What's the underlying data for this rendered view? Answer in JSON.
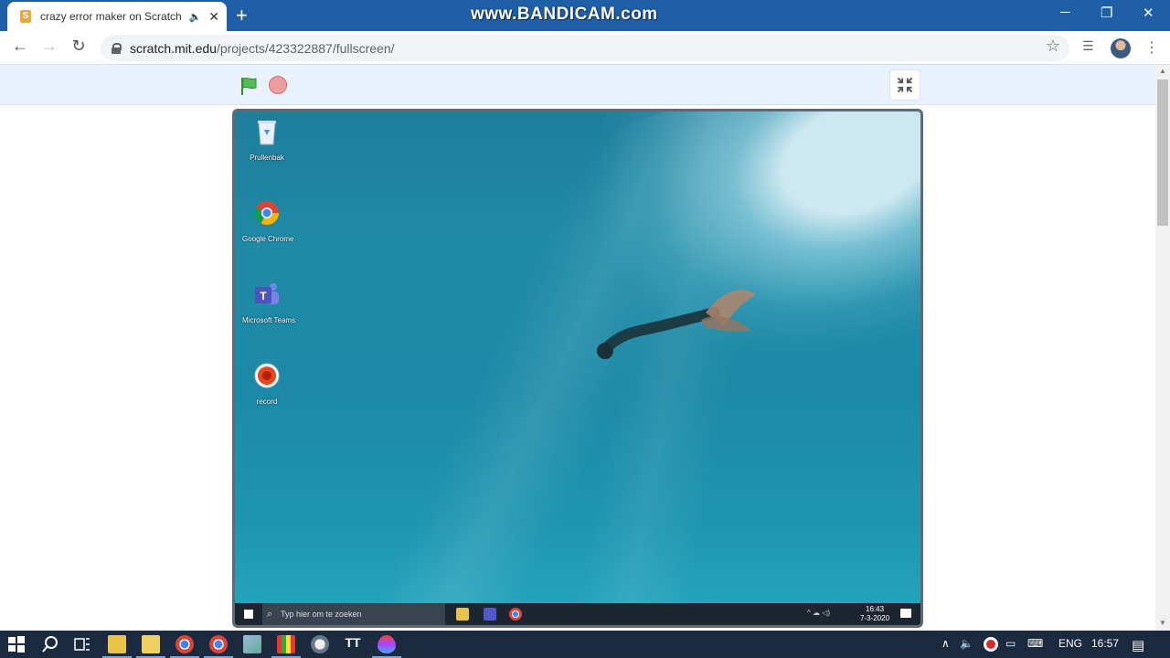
{
  "watermark": "www.BANDICAM.com",
  "browser": {
    "tab_title": "crazy error maker on Scratch",
    "tab_audio_icon": "speaker-icon",
    "tab_close": "✕",
    "new_tab": "+",
    "url_host": "scratch.mit.edu",
    "url_path": "/projects/423322887/fullscreen/",
    "window_controls": {
      "minimize": "─",
      "restore": "❐",
      "close": "✕"
    },
    "nav": {
      "back": "←",
      "forward": "→",
      "reload": "↻"
    },
    "bookmark": "☆",
    "menu": "⋮"
  },
  "scratch": {
    "green_flag_icon": "green-flag-icon",
    "stop_icon": "stop-icon",
    "exit_fullscreen_icon": "exit-fullscreen-icon"
  },
  "stage": {
    "desktop_icons": [
      {
        "label": "Prullenbak",
        "icon": "recycle-bin-icon"
      },
      {
        "label": "Google Chrome",
        "icon": "chrome-icon"
      },
      {
        "label": "Microsoft Teams",
        "icon": "teams-icon"
      },
      {
        "label": "record",
        "icon": "record-icon"
      }
    ],
    "taskbar_search_placeholder": "Typ hier om te zoeken",
    "clock_time": "16:43",
    "clock_date": "7-3-2020"
  },
  "taskbar": {
    "language": "ENG",
    "time": "16:57",
    "accent": "#1b2a3e"
  }
}
